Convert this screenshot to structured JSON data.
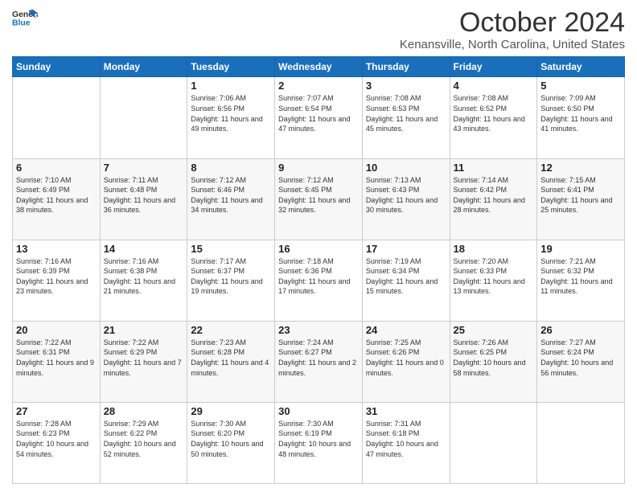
{
  "logo": {
    "line1": "General",
    "line2": "Blue"
  },
  "title": "October 2024",
  "subtitle": "Kenansville, North Carolina, United States",
  "days_of_week": [
    "Sunday",
    "Monday",
    "Tuesday",
    "Wednesday",
    "Thursday",
    "Friday",
    "Saturday"
  ],
  "weeks": [
    [
      {
        "day": "",
        "info": ""
      },
      {
        "day": "",
        "info": ""
      },
      {
        "day": "1",
        "info": "Sunrise: 7:06 AM\nSunset: 6:56 PM\nDaylight: 11 hours and 49 minutes."
      },
      {
        "day": "2",
        "info": "Sunrise: 7:07 AM\nSunset: 6:54 PM\nDaylight: 11 hours and 47 minutes."
      },
      {
        "day": "3",
        "info": "Sunrise: 7:08 AM\nSunset: 6:53 PM\nDaylight: 11 hours and 45 minutes."
      },
      {
        "day": "4",
        "info": "Sunrise: 7:08 AM\nSunset: 6:52 PM\nDaylight: 11 hours and 43 minutes."
      },
      {
        "day": "5",
        "info": "Sunrise: 7:09 AM\nSunset: 6:50 PM\nDaylight: 11 hours and 41 minutes."
      }
    ],
    [
      {
        "day": "6",
        "info": "Sunrise: 7:10 AM\nSunset: 6:49 PM\nDaylight: 11 hours and 38 minutes."
      },
      {
        "day": "7",
        "info": "Sunrise: 7:11 AM\nSunset: 6:48 PM\nDaylight: 11 hours and 36 minutes."
      },
      {
        "day": "8",
        "info": "Sunrise: 7:12 AM\nSunset: 6:46 PM\nDaylight: 11 hours and 34 minutes."
      },
      {
        "day": "9",
        "info": "Sunrise: 7:12 AM\nSunset: 6:45 PM\nDaylight: 11 hours and 32 minutes."
      },
      {
        "day": "10",
        "info": "Sunrise: 7:13 AM\nSunset: 6:43 PM\nDaylight: 11 hours and 30 minutes."
      },
      {
        "day": "11",
        "info": "Sunrise: 7:14 AM\nSunset: 6:42 PM\nDaylight: 11 hours and 28 minutes."
      },
      {
        "day": "12",
        "info": "Sunrise: 7:15 AM\nSunset: 6:41 PM\nDaylight: 11 hours and 25 minutes."
      }
    ],
    [
      {
        "day": "13",
        "info": "Sunrise: 7:16 AM\nSunset: 6:39 PM\nDaylight: 11 hours and 23 minutes."
      },
      {
        "day": "14",
        "info": "Sunrise: 7:16 AM\nSunset: 6:38 PM\nDaylight: 11 hours and 21 minutes."
      },
      {
        "day": "15",
        "info": "Sunrise: 7:17 AM\nSunset: 6:37 PM\nDaylight: 11 hours and 19 minutes."
      },
      {
        "day": "16",
        "info": "Sunrise: 7:18 AM\nSunset: 6:36 PM\nDaylight: 11 hours and 17 minutes."
      },
      {
        "day": "17",
        "info": "Sunrise: 7:19 AM\nSunset: 6:34 PM\nDaylight: 11 hours and 15 minutes."
      },
      {
        "day": "18",
        "info": "Sunrise: 7:20 AM\nSunset: 6:33 PM\nDaylight: 11 hours and 13 minutes."
      },
      {
        "day": "19",
        "info": "Sunrise: 7:21 AM\nSunset: 6:32 PM\nDaylight: 11 hours and 11 minutes."
      }
    ],
    [
      {
        "day": "20",
        "info": "Sunrise: 7:22 AM\nSunset: 6:31 PM\nDaylight: 11 hours and 9 minutes."
      },
      {
        "day": "21",
        "info": "Sunrise: 7:22 AM\nSunset: 6:29 PM\nDaylight: 11 hours and 7 minutes."
      },
      {
        "day": "22",
        "info": "Sunrise: 7:23 AM\nSunset: 6:28 PM\nDaylight: 11 hours and 4 minutes."
      },
      {
        "day": "23",
        "info": "Sunrise: 7:24 AM\nSunset: 6:27 PM\nDaylight: 11 hours and 2 minutes."
      },
      {
        "day": "24",
        "info": "Sunrise: 7:25 AM\nSunset: 6:26 PM\nDaylight: 11 hours and 0 minutes."
      },
      {
        "day": "25",
        "info": "Sunrise: 7:26 AM\nSunset: 6:25 PM\nDaylight: 10 hours and 58 minutes."
      },
      {
        "day": "26",
        "info": "Sunrise: 7:27 AM\nSunset: 6:24 PM\nDaylight: 10 hours and 56 minutes."
      }
    ],
    [
      {
        "day": "27",
        "info": "Sunrise: 7:28 AM\nSunset: 6:23 PM\nDaylight: 10 hours and 54 minutes."
      },
      {
        "day": "28",
        "info": "Sunrise: 7:29 AM\nSunset: 6:22 PM\nDaylight: 10 hours and 52 minutes."
      },
      {
        "day": "29",
        "info": "Sunrise: 7:30 AM\nSunset: 6:20 PM\nDaylight: 10 hours and 50 minutes."
      },
      {
        "day": "30",
        "info": "Sunrise: 7:30 AM\nSunset: 6:19 PM\nDaylight: 10 hours and 48 minutes."
      },
      {
        "day": "31",
        "info": "Sunrise: 7:31 AM\nSunset: 6:18 PM\nDaylight: 10 hours and 47 minutes."
      },
      {
        "day": "",
        "info": ""
      },
      {
        "day": "",
        "info": ""
      }
    ]
  ]
}
